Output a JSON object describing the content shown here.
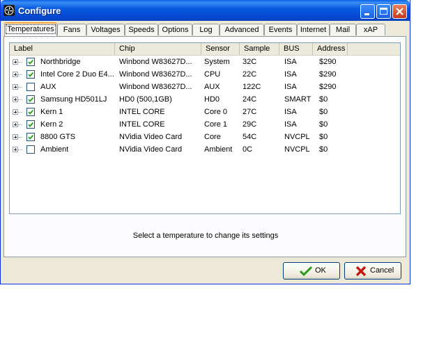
{
  "window": {
    "title": "Configure",
    "icon": "fan-icon"
  },
  "tabs": [
    {
      "label": "Temperatures",
      "active": true
    },
    {
      "label": "Fans"
    },
    {
      "label": "Voltages"
    },
    {
      "label": "Speeds"
    },
    {
      "label": "Options"
    },
    {
      "label": "Log"
    },
    {
      "label": "Advanced"
    },
    {
      "label": "Events"
    },
    {
      "label": "Internet"
    },
    {
      "label": "Mail"
    },
    {
      "label": "xAP"
    }
  ],
  "table": {
    "columns": [
      "Label",
      "Chip",
      "Sensor",
      "Sample",
      "BUS",
      "Address"
    ],
    "rows": [
      {
        "checked": true,
        "label": "Northbridge",
        "chip": "Winbond W83627D...",
        "sensor": "System",
        "sample": "32C",
        "bus": "ISA",
        "address": "$290"
      },
      {
        "checked": true,
        "label": "Intel Core 2 Duo E4...",
        "chip": "Winbond W83627D...",
        "sensor": "CPU",
        "sample": "22C",
        "bus": "ISA",
        "address": "$290"
      },
      {
        "checked": false,
        "label": "AUX",
        "chip": "Winbond W83627D...",
        "sensor": "AUX",
        "sample": "122C",
        "bus": "ISA",
        "address": "$290"
      },
      {
        "checked": true,
        "label": "Samsung HD501LJ",
        "chip": "HD0 (500,1GB)",
        "sensor": "HD0",
        "sample": "24C",
        "bus": "SMART",
        "address": "$0"
      },
      {
        "checked": true,
        "label": "Kern 1",
        "chip": "INTEL CORE",
        "sensor": "Core 0",
        "sample": "27C",
        "bus": "ISA",
        "address": "$0"
      },
      {
        "checked": true,
        "label": "Kern 2",
        "chip": "INTEL CORE",
        "sensor": "Core 1",
        "sample": "29C",
        "bus": "ISA",
        "address": "$0"
      },
      {
        "checked": true,
        "label": "8800 GTS",
        "chip": "NVidia Video Card",
        "sensor": "Core",
        "sample": "54C",
        "bus": "NVCPL",
        "address": "$0"
      },
      {
        "checked": false,
        "label": "Ambient",
        "chip": "NVidia Video Card",
        "sensor": "Ambient",
        "sample": "0C",
        "bus": "NVCPL",
        "address": "$0"
      }
    ]
  },
  "hint": "Select a temperature to change its settings",
  "buttons": {
    "ok": "OK",
    "cancel": "Cancel"
  },
  "colors": {
    "titlebar": "#0a5be0",
    "ok_check": "#2a9a1a",
    "cancel_x": "#c21a12",
    "tab_highlight": "#f5a43a"
  }
}
